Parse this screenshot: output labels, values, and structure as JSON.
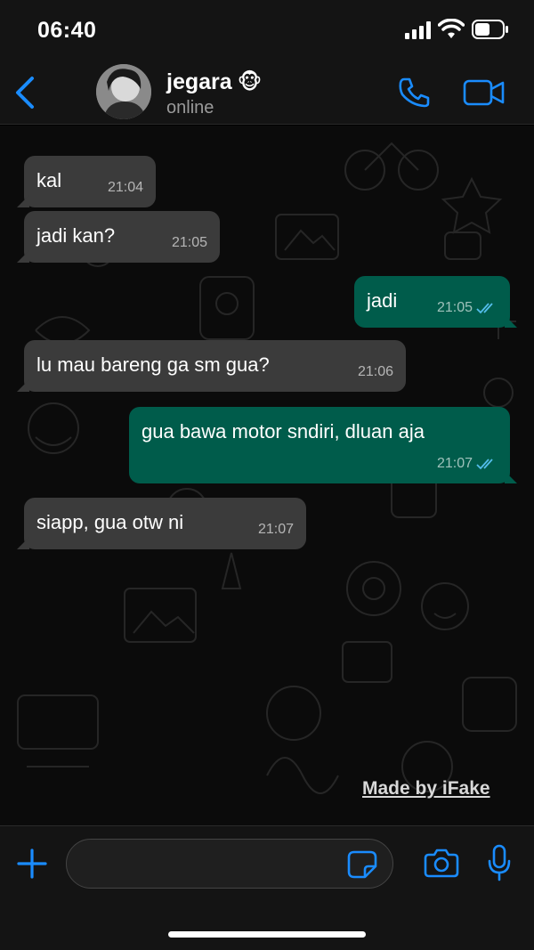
{
  "status_bar": {
    "time": "06:40"
  },
  "header": {
    "contact_name": "jegara",
    "contact_emoji": "🐵",
    "contact_status": "online"
  },
  "messages": [
    {
      "direction": "in",
      "text": "kal",
      "time": "21:04"
    },
    {
      "direction": "in",
      "text": "jadi kan?",
      "time": "21:05"
    },
    {
      "direction": "out",
      "text": "jadi",
      "time": "21:05",
      "read": true
    },
    {
      "direction": "in",
      "text": "lu mau bareng ga sm gua?",
      "time": "21:06"
    },
    {
      "direction": "out",
      "text": "gua bawa motor sndiri, dluan aja",
      "time": "21:07",
      "read": true
    },
    {
      "direction": "in",
      "text": "siapp, gua otw ni",
      "time": "21:07"
    }
  ],
  "watermark": "Made by iFake",
  "composer": {
    "input_value": ""
  },
  "colors": {
    "accent": "#1a8cff",
    "incoming_bubble": "#3b3b3b",
    "outgoing_bubble": "#005c4b",
    "read_ticks": "#53bdeb"
  },
  "icons": [
    "back-chevron-icon",
    "phone-icon",
    "video-camera-icon",
    "plus-icon",
    "sticker-icon",
    "camera-icon",
    "microphone-icon"
  ]
}
